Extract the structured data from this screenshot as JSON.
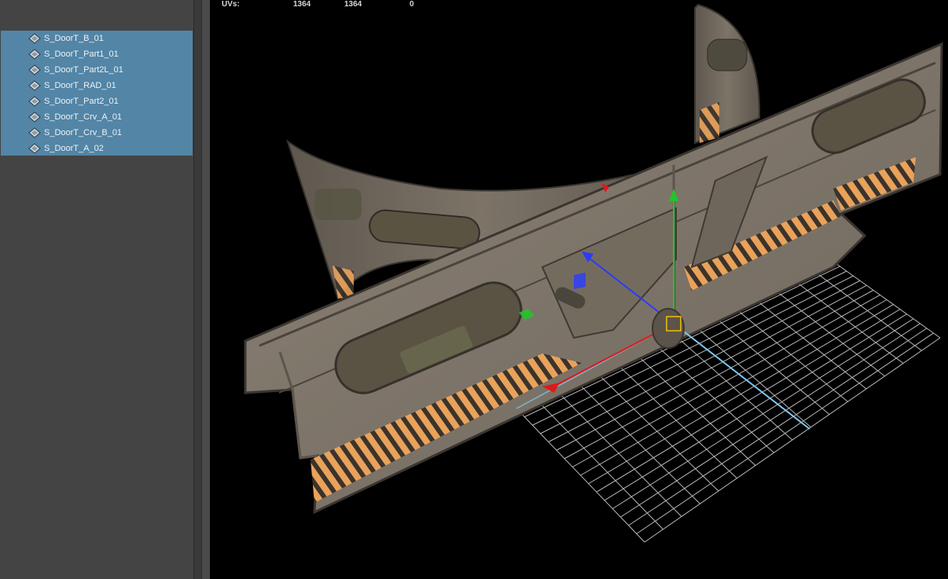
{
  "outliner": {
    "items": [
      {
        "label": "S_DoorT_B_01"
      },
      {
        "label": "S_DoorT_Part1_01"
      },
      {
        "label": "S_DoorT_Part2L_01"
      },
      {
        "label": "S_DoorT_RAD_01"
      },
      {
        "label": "S_DoorT_Part2_01"
      },
      {
        "label": "S_DoorT_Crv_A_01"
      },
      {
        "label": "S_DoorT_Crv_B_01"
      },
      {
        "label": "S_DoorT_A_02"
      }
    ],
    "item_icon": "mesh-transform-icon",
    "selection_color": "#5285a6"
  },
  "viewport": {
    "hud": {
      "label": "UVs:",
      "val1": "1364",
      "val2": "1364",
      "val3": "0"
    },
    "colors": {
      "background": "#000000",
      "grid": "#d9d9d9",
      "axis_y": "#22c42a",
      "axis_z": "#2a3cff",
      "axis_x": "#e01818",
      "axis_ext": "#7fc6f0",
      "pivot": "#f2c200"
    }
  }
}
